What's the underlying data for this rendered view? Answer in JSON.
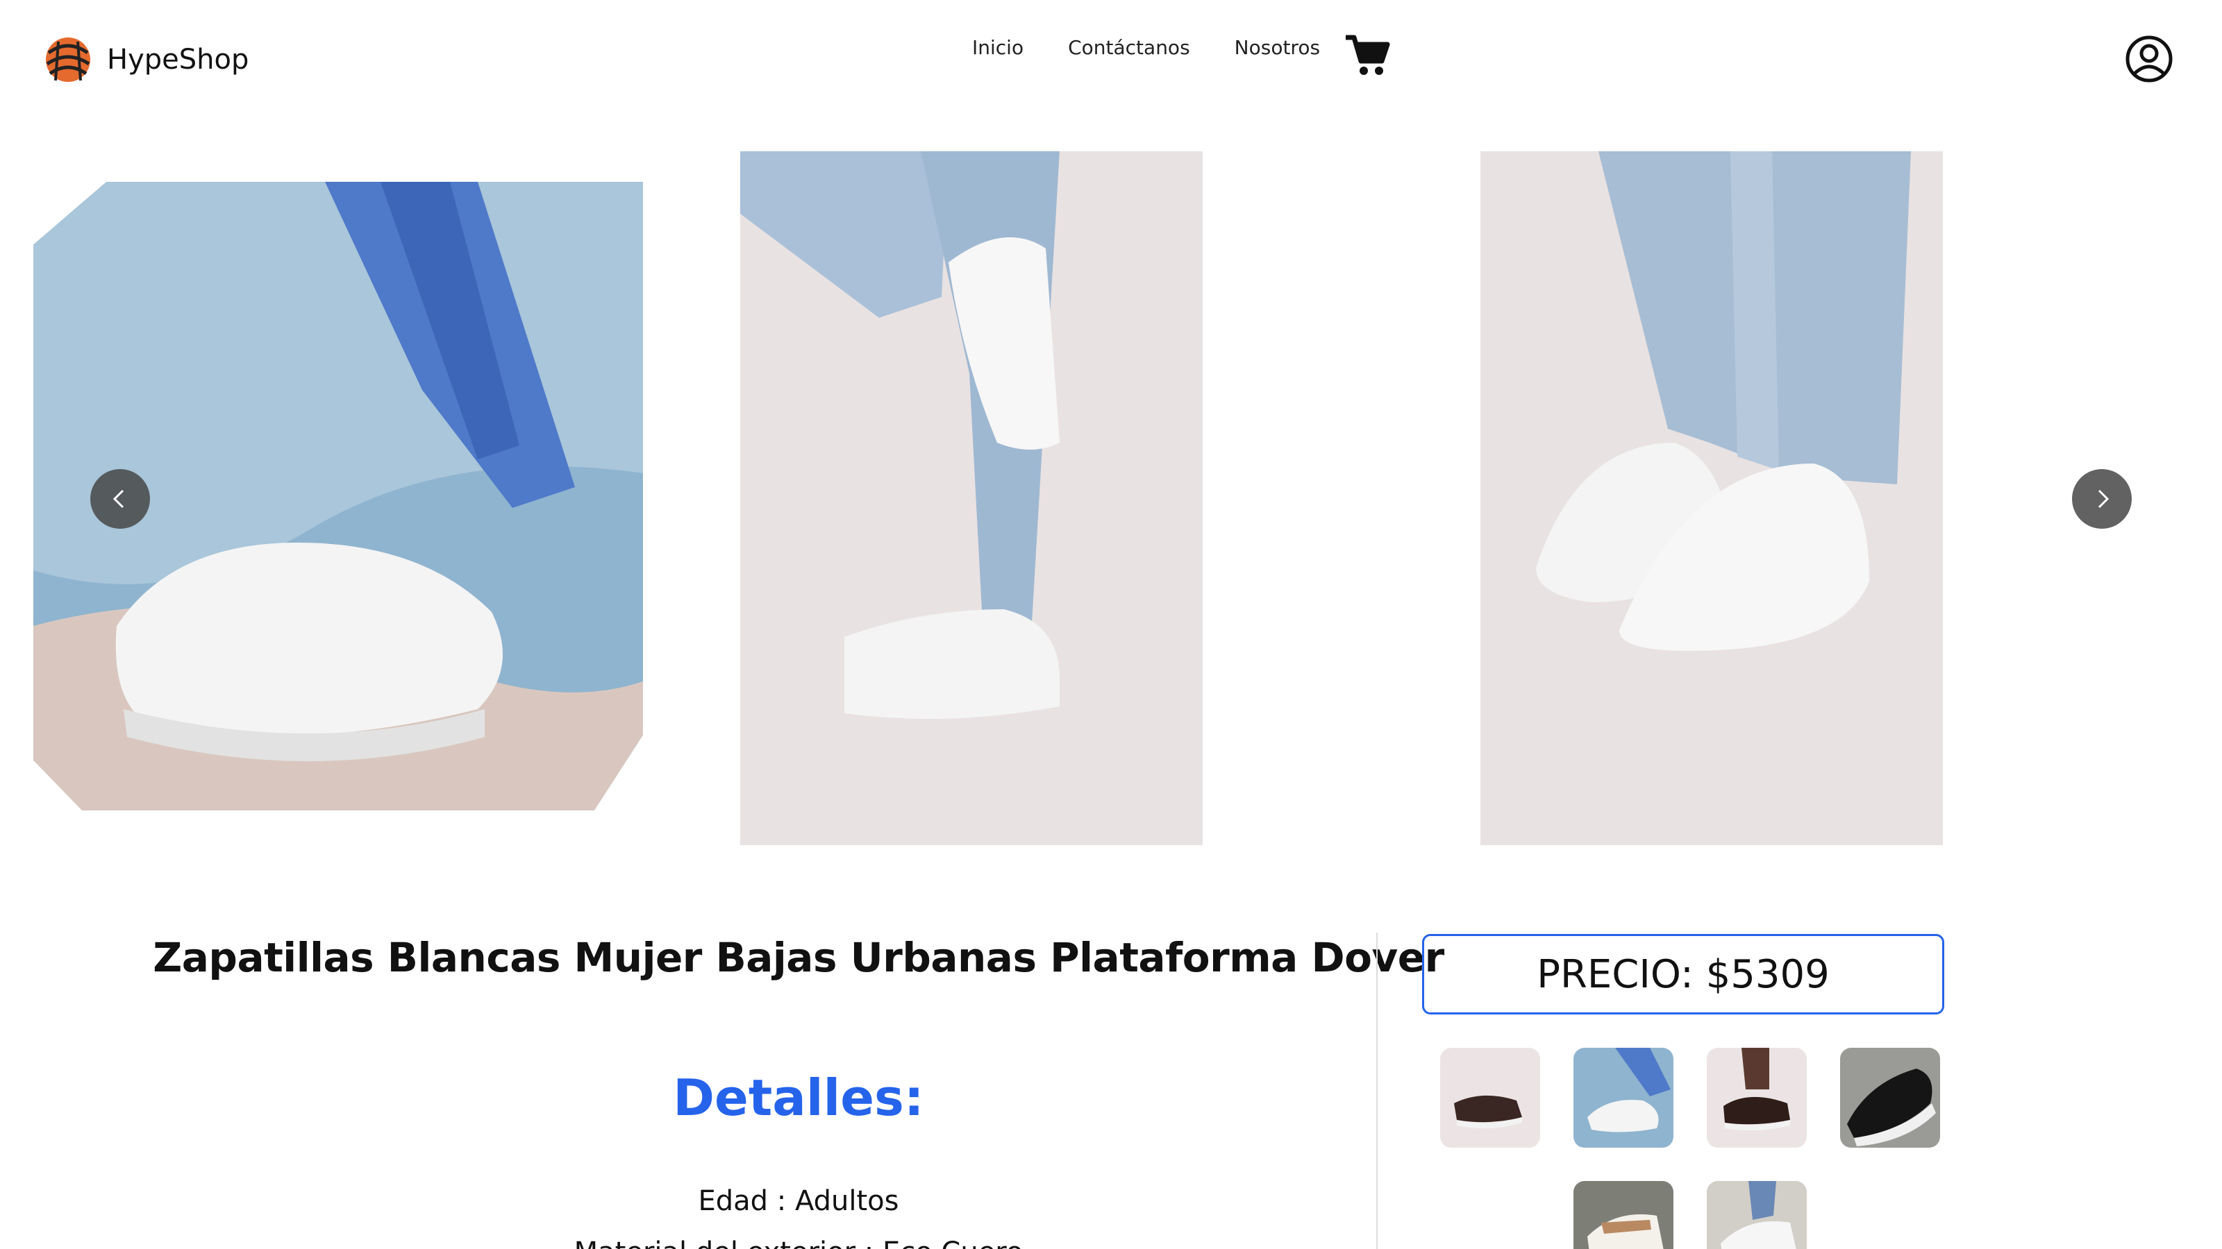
{
  "header": {
    "brand_name": "HypeShop",
    "nav": [
      "Inicio",
      "Contáctanos",
      "Nosotros"
    ]
  },
  "product": {
    "title": "Zapatillas Blancas Mujer Bajas Urbanas Plataforma Dover",
    "price_label": "PRECIO: $5309",
    "details_heading": "Detalles:",
    "details": [
      "Edad : Adultos",
      "Material del exterior : Eco Cuero"
    ]
  },
  "colors": {
    "accent": "#2563eb",
    "text": "#111111",
    "divider": "#dcdcdc"
  }
}
